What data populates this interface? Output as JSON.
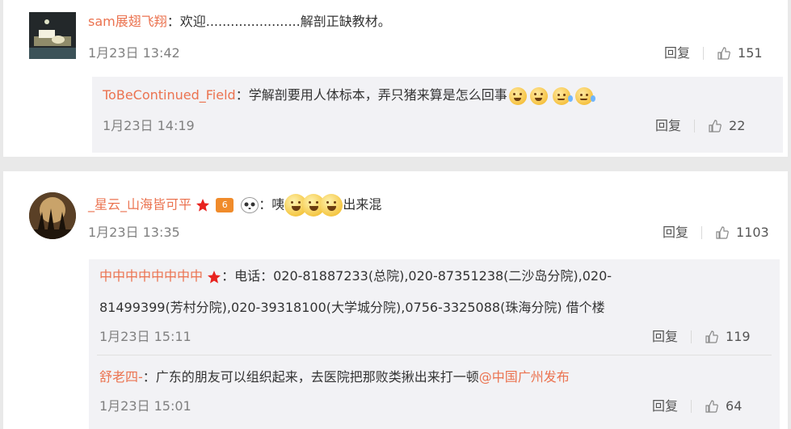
{
  "comments": [
    {
      "user": "sam展翅飞翔",
      "text": "：欢迎.......................解剖正缺教材。",
      "time": "1月23日 13:42",
      "reply": "回复",
      "likes": "151",
      "replies": [
        {
          "user": "ToBeContinued_Field",
          "text": "：学解剖要用人体标本，弄只猪来算是怎么回事",
          "emojis": [
            "dizzy-emoji",
            "dizzy-emoji",
            "sweat-emoji",
            "sweat-emoji"
          ],
          "time": "1月23日 14:19",
          "reply": "回复",
          "likes": "22"
        }
      ]
    },
    {
      "user": "_星云_山海皆可平",
      "text_before": "：咦",
      "emojis": [
        "grin-emoji",
        "grin-emoji",
        "grin-emoji"
      ],
      "text_after": "出来混",
      "vip_badge": "6",
      "time": "1月23日 13:35",
      "reply": "回复",
      "likes": "1103",
      "replies": [
        {
          "user": "中中中中中中中中",
          "text_line1": "：电话：020-81887233(总院),020-87351238(二沙岛分院),020-",
          "text_line2": "81499399(芳村分院),020-39318100(大学城分院),0756-3325088(珠海分院) 借个楼",
          "time": "1月23日 15:11",
          "reply": "回复",
          "likes": "119"
        },
        {
          "user": "舒老四-",
          "text": "：广东的朋友可以组织起来，去医院把那败类揪出来打一顿",
          "mention": "@中国广州发布",
          "time": "1月23日 15:01",
          "reply": "回复",
          "likes": "64"
        }
      ]
    }
  ],
  "colors": {
    "username": "#eb7350",
    "text": "#333333",
    "meta": "#808080",
    "sub_background": "#f2f2f5",
    "page_background": "#e9e9e9"
  }
}
